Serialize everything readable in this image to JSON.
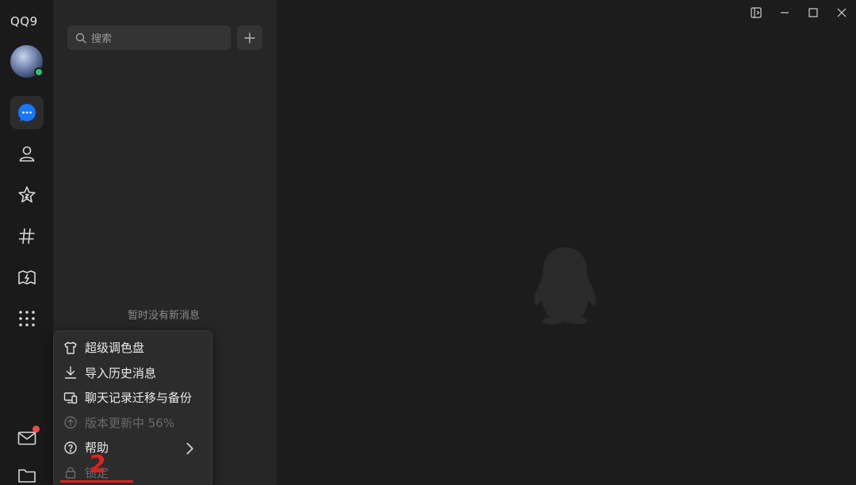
{
  "app": {
    "logo_text": "QQ9"
  },
  "rail": {
    "items": [
      {
        "name": "messages",
        "icon": "chat-bubble-icon",
        "active": true
      },
      {
        "name": "contacts",
        "icon": "person-icon"
      },
      {
        "name": "favorites",
        "icon": "star-icon"
      },
      {
        "name": "channels",
        "icon": "hashtag-icon"
      },
      {
        "name": "games",
        "icon": "game-icon"
      },
      {
        "name": "apps",
        "icon": "grid-icon"
      },
      {
        "name": "mail",
        "icon": "mail-icon",
        "badge": true
      },
      {
        "name": "files",
        "icon": "folder-icon"
      }
    ]
  },
  "list": {
    "search_placeholder": "搜索",
    "empty_text": "暂时没有新消息"
  },
  "menu": {
    "items": [
      {
        "label": "超级调色盘",
        "icon": "shirt-icon"
      },
      {
        "label": "导入历史消息",
        "icon": "download-icon"
      },
      {
        "label": "聊天记录迁移与备份",
        "icon": "devices-icon"
      },
      {
        "label": "版本更新中  56%",
        "icon": "upload-circle-icon",
        "disabled": true
      },
      {
        "label": "帮助",
        "icon": "help-circle-icon",
        "submenu": true
      },
      {
        "label": "锁定",
        "icon": "lock-icon",
        "disabled": true
      }
    ]
  },
  "annotation": {
    "text": "2"
  },
  "colors": {
    "accent": "#1677ff",
    "online": "#2ec26a",
    "badge": "#f24a4a",
    "annotation": "#e02020"
  }
}
